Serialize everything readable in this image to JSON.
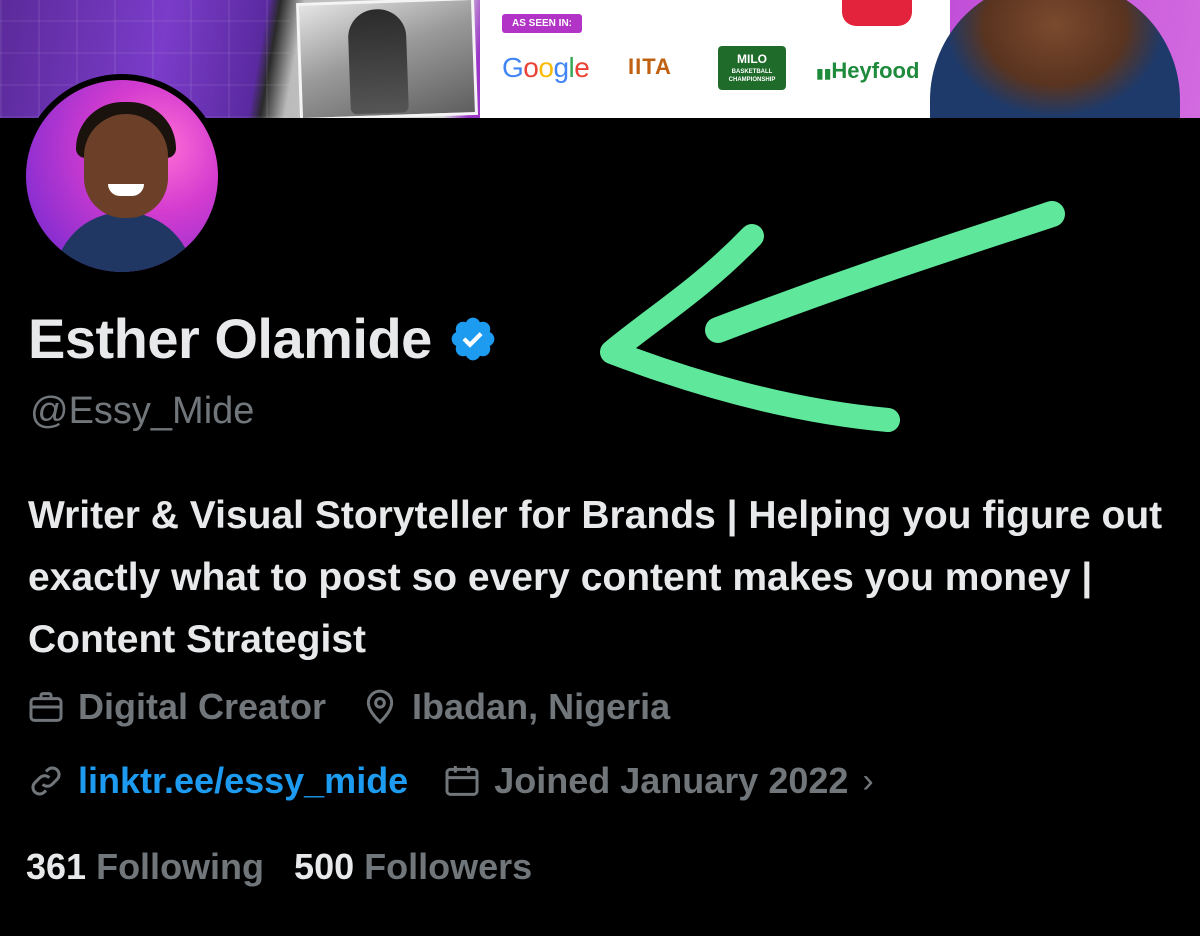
{
  "banner": {
    "seen_in_label": "AS SEEN IN:",
    "brands": [
      "Google",
      "IITA",
      "MILO",
      "Heyfood"
    ],
    "milo_sub": "BASKETBALL CHAMPIONSHIP"
  },
  "profile": {
    "display_name": "Esther Olamide",
    "handle": "@Essy_Mide",
    "verified_icon": "verified-badge-icon",
    "bio": "Writer & Visual Storyteller for Brands | Helping you figure out exactly what to post so every content makes you money | Content Strategist",
    "category": "Digital Creator",
    "location": "Ibadan, Nigeria",
    "website": "linktr.ee/essy_mide",
    "joined": "Joined January 2022",
    "joined_chevron": "›"
  },
  "stats": {
    "following_count": "361",
    "following_label": "Following",
    "followers_count": "500",
    "followers_label": "Followers"
  },
  "colors": {
    "background": "#000000",
    "primary_text": "#e7e9ea",
    "secondary_text": "#71767b",
    "link": "#1d9bf0",
    "verified": "#1d9bf0",
    "annotation": "#5fe89b"
  }
}
